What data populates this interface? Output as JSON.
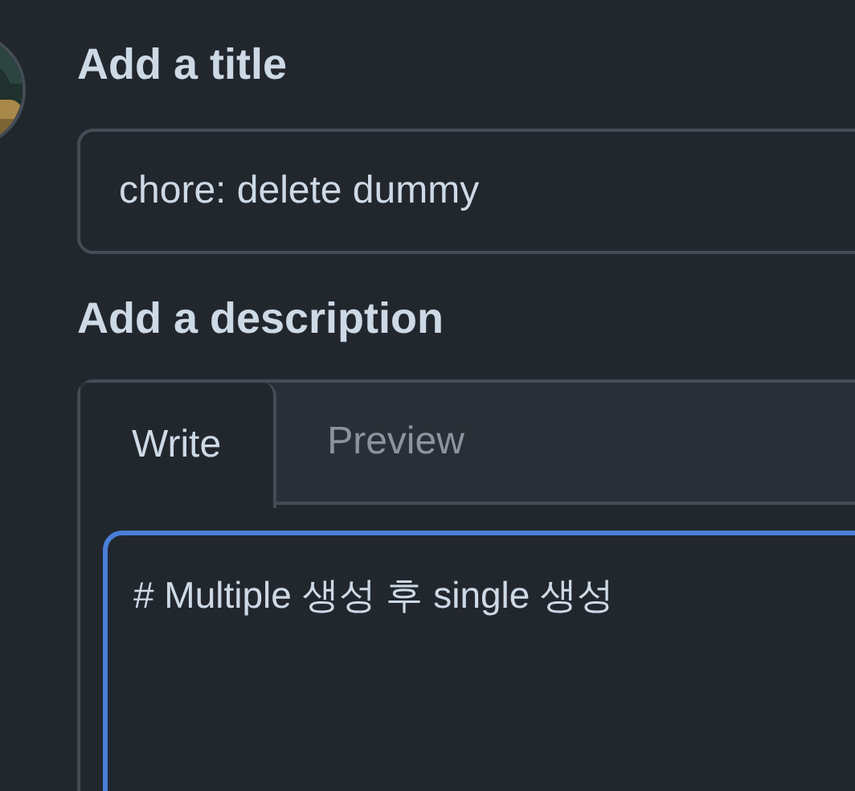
{
  "title_section": {
    "label": "Add a title",
    "value": "chore: delete dummy"
  },
  "description_section": {
    "label": "Add a description",
    "tabs": [
      {
        "label": "Write",
        "selected": true
      },
      {
        "label": "Preview",
        "selected": false
      }
    ],
    "body": "# Multiple 생성 후 single 생성",
    "focused": true
  }
}
